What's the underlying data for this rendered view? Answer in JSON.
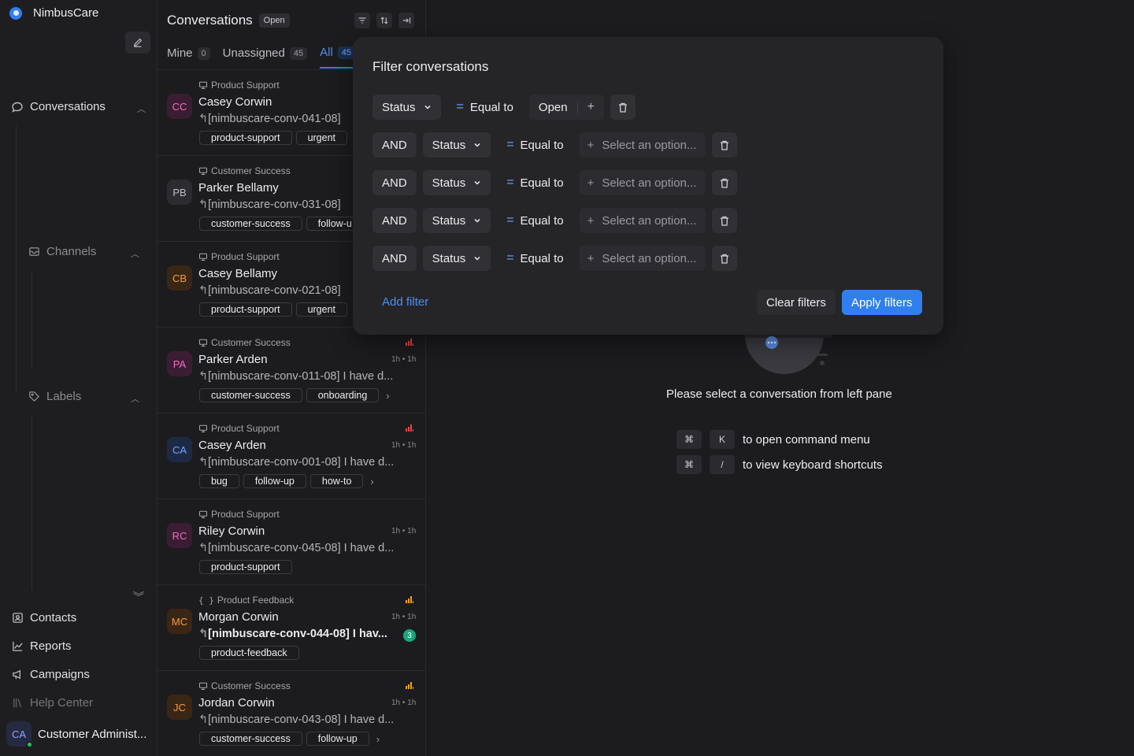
{
  "brand": {
    "name": "NimbusCare"
  },
  "sidebar": {
    "conversations_label": "Conversations",
    "channels_label": "Channels",
    "labels_label": "Labels",
    "bottom": [
      {
        "label": "Contacts",
        "icon": "contact-card-icon"
      },
      {
        "label": "Reports",
        "icon": "chart-line-icon"
      },
      {
        "label": "Campaigns",
        "icon": "megaphone-icon"
      },
      {
        "label": "Help Center",
        "icon": "library-icon"
      }
    ],
    "user": {
      "initials": "CA",
      "name": "Customer Administ..."
    }
  },
  "conversations": {
    "title": "Conversations",
    "status_badge": "Open",
    "tabs": [
      {
        "label": "Mine",
        "count": "0"
      },
      {
        "label": "Unassigned",
        "count": "45"
      },
      {
        "label": "All",
        "count": "45"
      }
    ],
    "items": [
      {
        "inbox": "Product Support",
        "initials": "CC",
        "name": "Casey Corwin",
        "message": "[nimbuscare-conv-041-08]",
        "time": "",
        "tags": [
          "product-support",
          "urgent"
        ],
        "bold": false,
        "unread": "",
        "priority": "",
        "avatar_bg": "#3a1d33",
        "avatar_fg": "#f06fc1"
      },
      {
        "inbox": "Customer Success",
        "initials": "PB",
        "name": "Parker Bellamy",
        "message": "[nimbuscare-conv-031-08]",
        "time": "",
        "tags": [
          "customer-success",
          "follow-u"
        ],
        "bold": false,
        "unread": "",
        "priority": "",
        "avatar_bg": "#2c2c30",
        "avatar_fg": "#bdbdc2"
      },
      {
        "inbox": "Product Support",
        "initials": "CB",
        "name": "Casey Bellamy",
        "message": "[nimbuscare-conv-021-08]",
        "time": "",
        "tags": [
          "product-support",
          "urgent"
        ],
        "bold": false,
        "unread": "",
        "priority": "",
        "avatar_bg": "#3a2615",
        "avatar_fg": "#f59e3b"
      },
      {
        "inbox": "Customer Success",
        "initials": "PA",
        "name": "Parker Arden",
        "message": "[nimbuscare-conv-011-08] I have d...",
        "time": "1h • 1h",
        "tags": [
          "customer-success",
          "onboarding"
        ],
        "bold": false,
        "unread": "",
        "priority": "urgent",
        "avatar_bg": "#3a1d33",
        "avatar_fg": "#f06fc1"
      },
      {
        "inbox": "Product Support",
        "initials": "CA",
        "name": "Casey Arden",
        "message": "[nimbuscare-conv-001-08] I have d...",
        "time": "1h • 1h",
        "tags": [
          "bug",
          "follow-up",
          "how-to"
        ],
        "bold": false,
        "unread": "",
        "priority": "urgent",
        "avatar_bg": "#1c2a45",
        "avatar_fg": "#6aa6ff"
      },
      {
        "inbox": "Product Support",
        "initials": "RC",
        "name": "Riley Corwin",
        "message": "[nimbuscare-conv-045-08] I have d...",
        "time": "1h • 1h",
        "tags": [
          "product-support"
        ],
        "bold": false,
        "unread": "",
        "priority": "",
        "avatar_bg": "#3a1d33",
        "avatar_fg": "#f06fc1"
      },
      {
        "inbox": "Product Feedback",
        "initials": "MC",
        "name": "Morgan Corwin",
        "message": "[nimbuscare-conv-044-08] I hav...",
        "time": "1h • 1h",
        "tags": [
          "product-feedback"
        ],
        "bold": true,
        "unread": "3",
        "priority": "medium",
        "avatar_bg": "#3a2615",
        "avatar_fg": "#f59e3b"
      },
      {
        "inbox": "Customer Success",
        "initials": "JC",
        "name": "Jordan Corwin",
        "message": "[nimbuscare-conv-043-08] I have d...",
        "time": "1h • 1h",
        "tags": [
          "customer-success",
          "follow-up"
        ],
        "bold": false,
        "unread": "",
        "priority": "high",
        "avatar_bg": "#3a2615",
        "avatar_fg": "#f59e3b"
      }
    ]
  },
  "main": {
    "empty_text": "Please select a conversation from left pane",
    "shortcuts": [
      {
        "key1": "⌘",
        "key2": "K",
        "text": "to open command menu"
      },
      {
        "key1": "⌘",
        "key2": "/",
        "text": "to view keyboard shortcuts"
      }
    ]
  },
  "filter_modal": {
    "title": "Filter conversations",
    "rows": [
      {
        "conj": "",
        "field": "Status",
        "operator": "Equal to",
        "value": "Open",
        "placeholder": ""
      },
      {
        "conj": "AND",
        "field": "Status",
        "operator": "Equal to",
        "value": "",
        "placeholder": "Select an option..."
      },
      {
        "conj": "AND",
        "field": "Status",
        "operator": "Equal to",
        "value": "",
        "placeholder": "Select an option..."
      },
      {
        "conj": "AND",
        "field": "Status",
        "operator": "Equal to",
        "value": "",
        "placeholder": "Select an option..."
      },
      {
        "conj": "AND",
        "field": "Status",
        "operator": "Equal to",
        "value": "",
        "placeholder": "Select an option..."
      }
    ],
    "add_filter_label": "Add filter",
    "clear_label": "Clear filters",
    "apply_label": "Apply filters"
  },
  "colors": {
    "accent": "#2f7ff0",
    "background": "#1c1c1f",
    "modal": "#252528"
  }
}
